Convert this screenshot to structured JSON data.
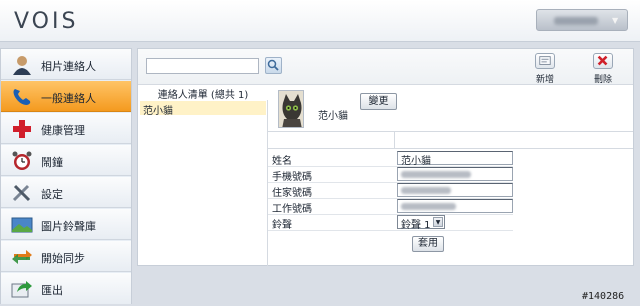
{
  "header": {
    "logo": "VOIS"
  },
  "sidebar": {
    "items": [
      {
        "label": "相片連絡人",
        "icon": "person-icon"
      },
      {
        "label": "一般連絡人",
        "icon": "phone-icon",
        "active": true
      },
      {
        "label": "健康管理",
        "icon": "red-cross-icon"
      },
      {
        "label": "鬧鐘",
        "icon": "alarm-clock-icon"
      },
      {
        "label": "設定",
        "icon": "tools-icon"
      },
      {
        "label": "圖片鈴聲庫",
        "icon": "image-icon"
      },
      {
        "label": "開始同步",
        "icon": "sync-icon"
      },
      {
        "label": "匯出",
        "icon": "export-icon"
      }
    ]
  },
  "toolbar": {
    "add_label": "新增",
    "delete_label": "刪除",
    "search_placeholder": ""
  },
  "contact_list": {
    "header": "連絡人清單 (總共 1)",
    "items": [
      "范小貓"
    ]
  },
  "detail": {
    "name": "范小貓",
    "change_button": "變更",
    "fields": [
      {
        "label": "姓名",
        "value": "范小貓"
      },
      {
        "label": "手機號碼",
        "value": ""
      },
      {
        "label": "住家號碼",
        "value": ""
      },
      {
        "label": "工作號碼",
        "value": ""
      }
    ],
    "ringtone_label": "鈴聲",
    "ringtone_value": "鈴聲 1",
    "apply_button": "套用"
  },
  "watermark": "#140286",
  "colors": {
    "active_item": "#f49a1f",
    "selected_row": "#fff2c7"
  }
}
